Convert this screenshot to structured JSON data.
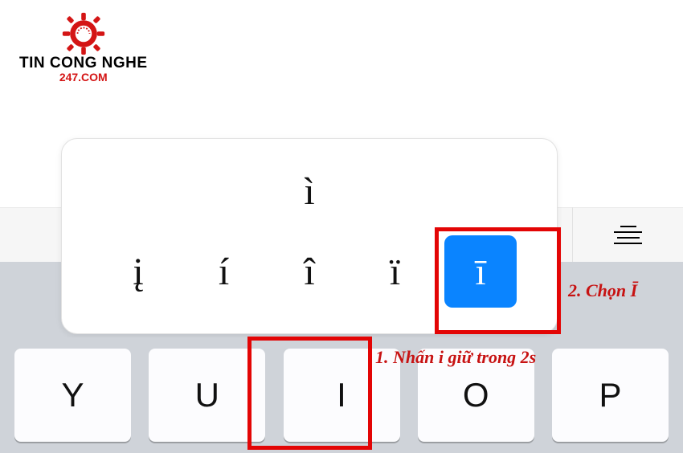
{
  "logo": {
    "line1": "TIN CONG NGHE",
    "line2": "247.COM",
    "gear_color": "#d41515"
  },
  "popup": {
    "top_char": "ì",
    "options": [
      "į",
      "í",
      "î",
      "ï",
      "ī"
    ],
    "selected_index": 4
  },
  "keys": [
    "Y",
    "U",
    "I",
    "O",
    "P"
  ],
  "highlighted_key_index": 2,
  "annotations": {
    "step1": "1. Nhấn i giữ trong 2s",
    "step2": "2. Chọn Ī"
  },
  "colors": {
    "accent_red": "#e30505",
    "selection_blue": "#0a84ff"
  }
}
